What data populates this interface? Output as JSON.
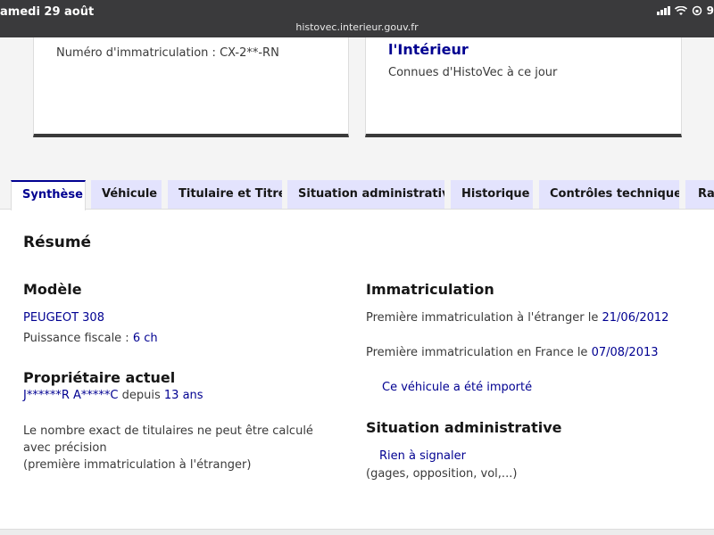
{
  "status_bar": {
    "time": "amedi 29 août",
    "url": "histovec.interieur.gouv.fr",
    "battery": "9"
  },
  "cards": {
    "left": {
      "plate": "Numéro d'immatriculation : CX-2**-RN"
    },
    "right": {
      "title": "l'Intérieur",
      "subtitle": "Connues d'HistoVec à ce jour"
    }
  },
  "tabs": [
    {
      "label": "Synthèse"
    },
    {
      "label": "Véhicule"
    },
    {
      "label": "Titulaire et Titre"
    },
    {
      "label": "Situation administrative"
    },
    {
      "label": "Historique"
    },
    {
      "label": "Contrôles techniques"
    },
    {
      "label": "Rap"
    }
  ],
  "summary": {
    "title": "Résumé",
    "model": {
      "heading": "Modèle",
      "name": "PEUGEOT 308",
      "power_label": "Puissance fiscale :",
      "power_value": "6 ch"
    },
    "owner": {
      "heading": "Propriétaire actuel",
      "name": "J******R A*****C",
      "since_label": "depuis",
      "since_value": "13 ans",
      "note_line1": "Le nombre exact de titulaires ne peut être calculé avec précision",
      "note_line2": "(première immatriculation à l'étranger)"
    },
    "registration": {
      "heading": "Immatriculation",
      "foreign_label": "Première immatriculation à l'étranger le",
      "foreign_date": "21/06/2012",
      "france_label": "Première immatriculation en France le",
      "france_date": "07/08/2013",
      "imported_link": "Ce véhicule a été importé"
    },
    "admin": {
      "heading": "Situation administrative",
      "status_link": "Rien à signaler",
      "details": "(gages, opposition, vol,...)"
    }
  },
  "colors": {
    "accent": "#000091",
    "tab_bg": "#e3e3fd",
    "text": "#3a3a3a"
  }
}
